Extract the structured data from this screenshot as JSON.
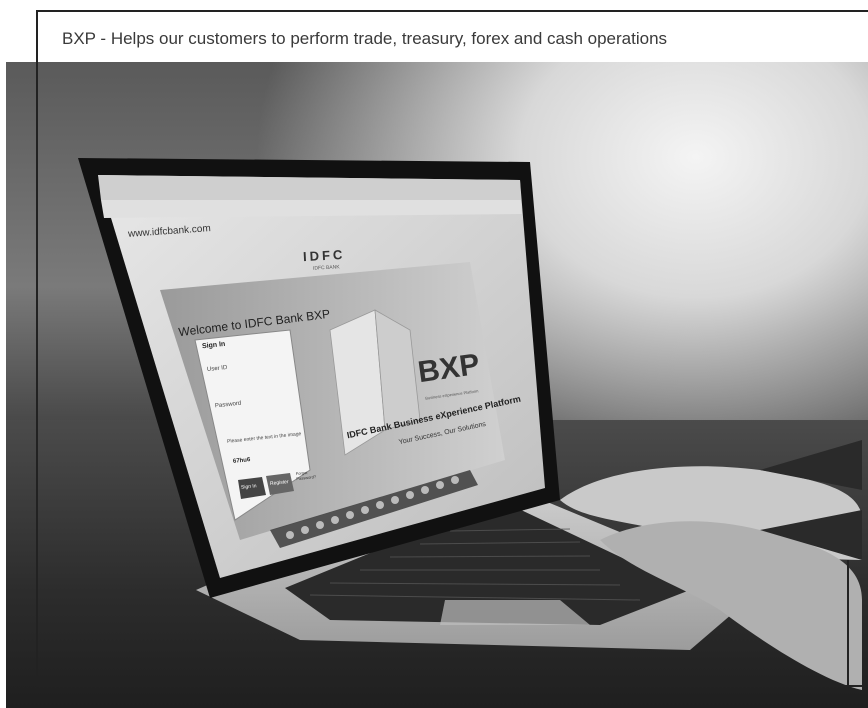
{
  "caption": "BXP - Helps our customers to perform trade, treasury, forex and cash operations",
  "screen": {
    "url": "www.idfcbank.com",
    "logo": "IDFC",
    "logo_sub": "IDFC BANK",
    "welcome": "Welcome to IDFC Bank BXP",
    "signin_title": "Sign In",
    "user_id_label": "User ID",
    "password_label": "Password",
    "captcha_prompt": "Please enter the text in the image",
    "captcha_text": "67hu6",
    "signin_button": "Sign In",
    "register_button": "Register",
    "forgot_link": "Forgot Password?",
    "brand_short": "BXP",
    "brand_tagline": "Business eXperience Platform",
    "platform_title": "IDFC Bank Business eXperience Platform",
    "platform_slogan": "Your Success, Our Solutions"
  }
}
